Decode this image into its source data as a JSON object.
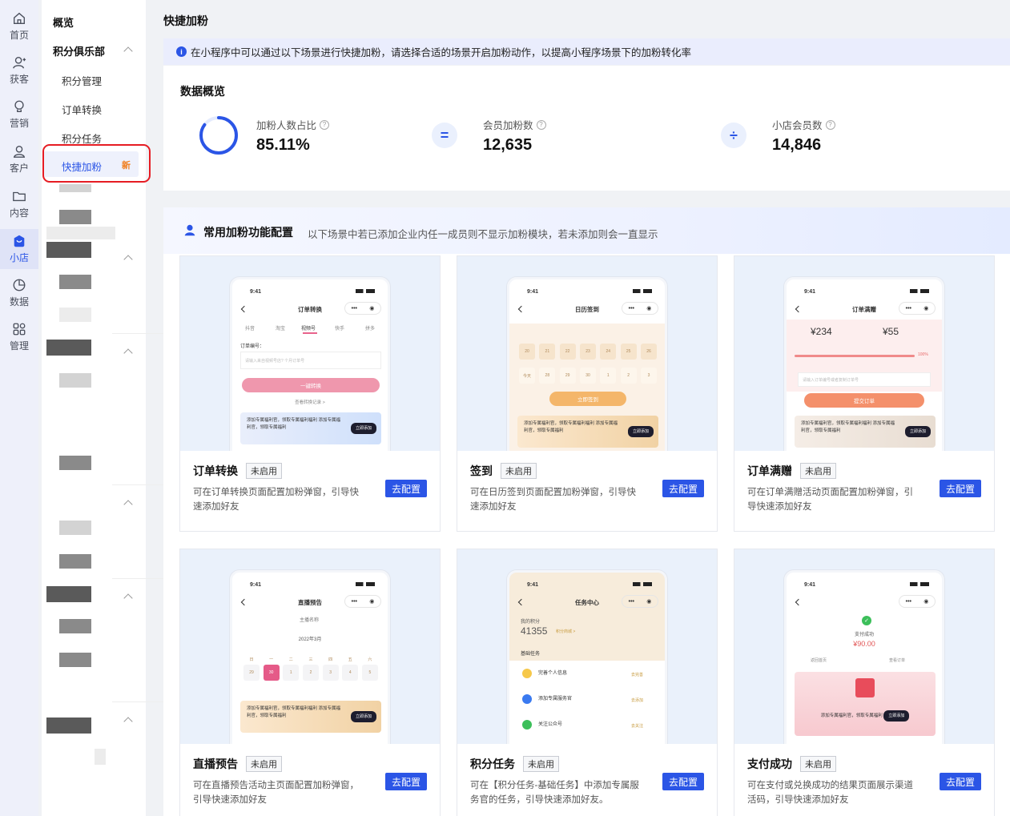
{
  "rail": [
    {
      "label": "首页",
      "icon": "home-icon"
    },
    {
      "label": "获客",
      "icon": "user-add-icon"
    },
    {
      "label": "营销",
      "icon": "bulb-icon"
    },
    {
      "label": "客户",
      "icon": "user-icon"
    },
    {
      "label": "内容",
      "icon": "folder-icon"
    },
    {
      "label": "小店",
      "icon": "shop-icon",
      "active": true
    },
    {
      "label": "数据",
      "icon": "pie-chart-icon"
    },
    {
      "label": "管理",
      "icon": "apps-icon"
    }
  ],
  "submenu": {
    "overview": "概览",
    "group": "积分俱乐部",
    "items": [
      "积分管理",
      "订单转换",
      "积分任务"
    ],
    "active": {
      "label": "快捷加粉",
      "badge": "新"
    }
  },
  "page_title": "快捷加粉",
  "notice": "在小程序中可以通过以下场景进行快捷加粉，请选择合适的场景开启加粉动作，以提高小程序场景下的加粉转化率",
  "overview": {
    "title": "数据概览",
    "ratio": {
      "label": "加粉人数占比",
      "value": "85.11%",
      "fraction": 0.8511
    },
    "op1": "=",
    "members_added": {
      "label": "会员加粉数",
      "value": "12,635"
    },
    "op2": "÷",
    "store_members": {
      "label": "小店会员数",
      "value": "14,846"
    }
  },
  "config": {
    "title": "常用加粉功能配置",
    "desc": "以下场景中若已添加企业内任一成员则不显示加粉模块，若未添加则会一直显示"
  },
  "status_label": "未启用",
  "config_button": "去配置",
  "phone_time": "9:41",
  "cards": [
    {
      "name": "订单转换",
      "desc": "可在订单转换页面配置加粉弹窗，引导快速添加好友",
      "phone": {
        "title": "订单转换",
        "tabs": [
          "抖音",
          "淘宝",
          "视频号",
          "快手",
          "拼多"
        ],
        "field_label": "订单编号：",
        "placeholder": "请输入来自视频号店? 个月订单号",
        "button": "一键转换",
        "link": "查看转换记录 >",
        "banner": "添加专属福利官，领取专属福利福利 添加专属福利官，领取专属福利",
        "banner_btn": "立即添加"
      }
    },
    {
      "name": "签到",
      "desc": "可在日历签到页面配置加粉弹窗，引导快速添加好友",
      "phone": {
        "title": "日历签到",
        "days_row1": [
          "20",
          "21",
          "22",
          "23",
          "24",
          "25",
          "26"
        ],
        "days_row2": [
          "今天",
          "28",
          "29",
          "30",
          "1",
          "2",
          "3"
        ],
        "button": "立即签到",
        "banner": "添加专属福利官，领取专属福利福利 添加专属福利官，领取专属福利",
        "banner_btn": "立即添加"
      }
    },
    {
      "name": "订单满赠",
      "desc": "可在订单满赠活动页面配置加粉弹窗，引导快速添加好友",
      "phone": {
        "title": "订单满赠",
        "amount1": "¥234",
        "amount2": "¥55",
        "progress_label": "100%",
        "placeholder": "请输入订单编号或者复制订单号",
        "button": "提交订单",
        "banner": "添加专属福利官，领取专属福利福利 添加专属福利官，领取专属福利",
        "banner_btn": "立即添加"
      }
    },
    {
      "name": "直播预告",
      "desc": "可在直播预告活动主页面配置加粉弹窗，引导快速添加好友",
      "phone": {
        "title": "直播预告",
        "anchor": "主播名称",
        "month": "2022年3月",
        "weekdays": [
          "日",
          "一",
          "二",
          "三",
          "四",
          "五",
          "六"
        ],
        "days": [
          "29",
          "30",
          "1",
          "2",
          "3",
          "4",
          "5"
        ],
        "banner": "添加专属福利官，领取专属福利福利 添加专属福利官，领取专属福利",
        "banner_btn": "立即添加"
      }
    },
    {
      "name": "积分任务",
      "desc": "可在【积分任务-基础任务】中添加专属服务官的任务，引导快速添加好友。",
      "phone": {
        "title": "任务中心",
        "points_label": "我的积分",
        "points": "41355",
        "points_tag": "积分商城 >",
        "section": "基础任务",
        "tasks": [
          {
            "name": "完善个人信息",
            "action": "去完善"
          },
          {
            "name": "添加专属服务官",
            "action": "去添加"
          },
          {
            "name": "关注公众号",
            "action": "去关注"
          }
        ]
      }
    },
    {
      "name": "支付成功",
      "desc": "可在支付或兑换成功的结果页面展示渠道活码，引导快速添加好友",
      "phone": {
        "title": "",
        "success": "支付成功",
        "amount": "¥90.00",
        "link1": "返回首页",
        "link2": "查看订单",
        "banner": "添加专属福利官，领取专属福利",
        "banner_btn": "立即添加"
      }
    }
  ],
  "colors": {
    "primary": "#2b55e6",
    "badge": "#f07c1b",
    "highlight": "#e61c23"
  }
}
